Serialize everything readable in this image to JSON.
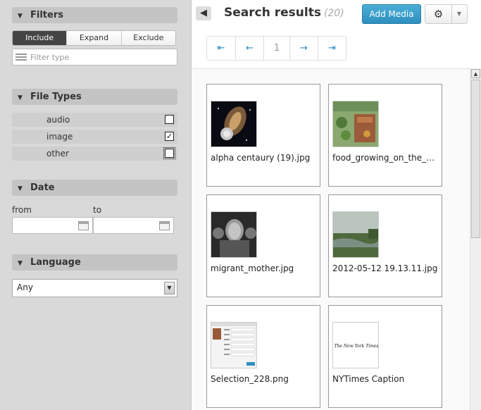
{
  "sidebar": {
    "filters": {
      "title": "Filters",
      "modes": [
        "Include",
        "Expand",
        "Exclude"
      ],
      "active_mode": "Include",
      "filter_placeholder": "Filter type"
    },
    "file_types": {
      "title": "File Types",
      "items": [
        {
          "label": "audio",
          "checked": false
        },
        {
          "label": "image",
          "checked": true
        },
        {
          "label": "other",
          "checked": false
        }
      ]
    },
    "date": {
      "title": "Date",
      "from_label": "from",
      "to_label": "to"
    },
    "language": {
      "title": "Language",
      "selected": "Any"
    }
  },
  "main": {
    "title": "Search results",
    "count": "(20)",
    "add_media_label": "Add Media",
    "pager": {
      "first": "⇤",
      "prev": "←",
      "current": "1",
      "next": "→",
      "last": "⇥"
    },
    "results": [
      {
        "name": "alpha centaury (19).jpg",
        "thumb": "space-thumbnail"
      },
      {
        "name": "food_growing_on_the_r…",
        "thumb": "garden-thumbnail"
      },
      {
        "name": "migrant_mother.jpg",
        "thumb": "portrait-thumbnail"
      },
      {
        "name": "2012-05-12 19.13.11.jpg",
        "thumb": "landscape-thumbnail"
      },
      {
        "name": "Selection_228.png",
        "thumb": "screenshot-thumbnail"
      },
      {
        "name": "NYTimes Caption",
        "thumb": "newspaper-thumbnail",
        "thumb_text": "The New York Times"
      }
    ]
  },
  "colors": {
    "accent": "#2d8fbe",
    "sidebar_bg": "#d9d9d9",
    "section_head": "#c4c4c4"
  }
}
